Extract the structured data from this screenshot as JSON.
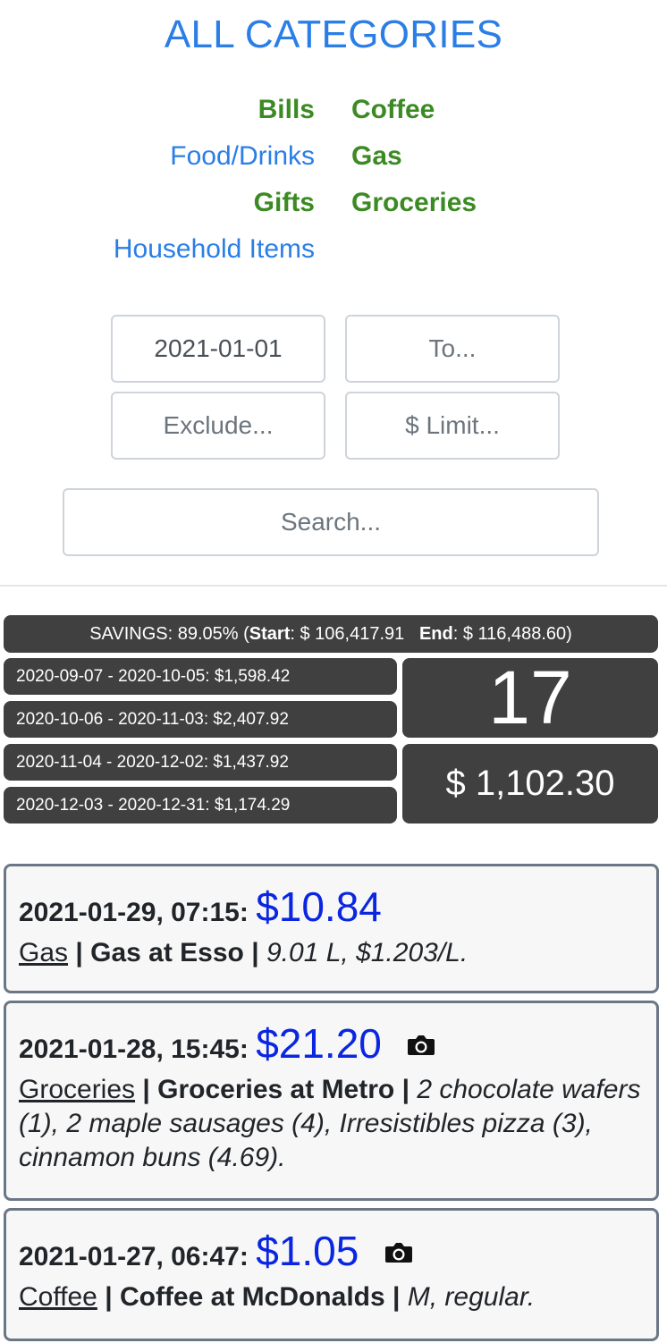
{
  "header": {
    "title": "ALL CATEGORIES"
  },
  "categories": [
    {
      "label": "Bills",
      "style": "green"
    },
    {
      "label": "Coffee",
      "style": "green"
    },
    {
      "label": "Food/Drinks",
      "style": "blue"
    },
    {
      "label": "Gas",
      "style": "green"
    },
    {
      "label": "Gifts",
      "style": "green"
    },
    {
      "label": "Groceries",
      "style": "green"
    },
    {
      "label": "Household Items",
      "style": "blue"
    }
  ],
  "filters": {
    "from_value": "2021-01-01",
    "to_placeholder": "To...",
    "exclude_placeholder": "Exclude...",
    "limit_placeholder": "$ Limit...",
    "search_placeholder": "Search..."
  },
  "summary": {
    "savings_label": "SAVINGS: 89.05% (",
    "start_label": "Start",
    "start_value": ": $ 106,417.91",
    "end_label": "End",
    "end_value": ": $ 116,488.60)",
    "periods": [
      "2020-09-07 - 2020-10-05: $1,598.42",
      "2020-10-06 - 2020-11-03: $2,407.92",
      "2020-11-04 - 2020-12-02: $1,437.92",
      "2020-12-03 - 2020-12-31: $1,174.29"
    ],
    "count": "17",
    "total": "$ 1,102.30"
  },
  "transactions": [
    {
      "datetime": "2021-01-29, 07:15",
      "amount": "$10.84",
      "category": "Gas",
      "vendor": "Gas at Esso",
      "note": "9.01 L, $1.203/L.",
      "has_photo": false
    },
    {
      "datetime": "2021-01-28, 15:45",
      "amount": "$21.20",
      "category": "Groceries",
      "vendor": "Groceries at Metro",
      "note": "2 chocolate wafers (1), 2 maple sausages (4), Irresistibles pizza (3), cinnamon buns (4.69).",
      "has_photo": true
    },
    {
      "datetime": "2021-01-27, 06:47",
      "amount": "$1.05",
      "category": "Coffee",
      "vendor": "Coffee at McDonalds",
      "note": "M, regular.",
      "has_photo": true
    }
  ],
  "icons": {
    "photo": "camera-icon"
  },
  "colors": {
    "accent_blue": "#2a7ee6",
    "category_green": "#3c8a23",
    "amount_blue": "#0a26e0",
    "summary_bg": "#404040"
  }
}
